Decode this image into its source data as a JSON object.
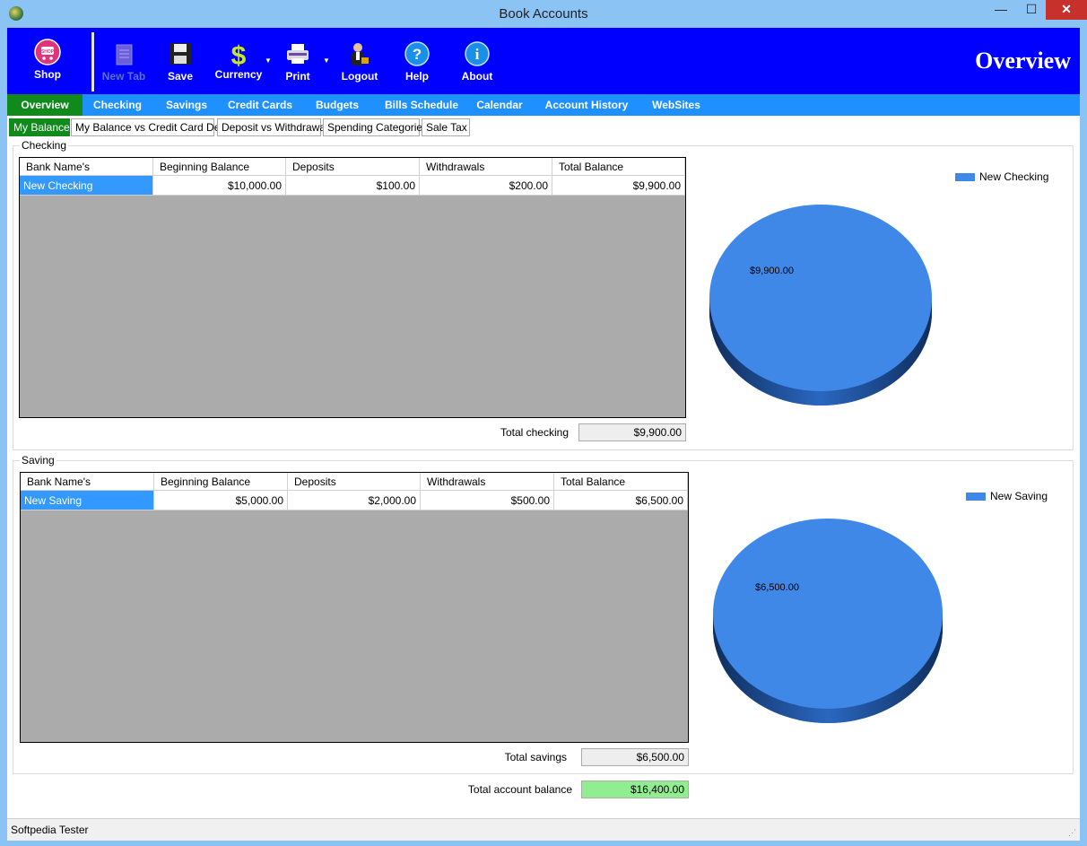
{
  "window": {
    "title": "Book Accounts",
    "min": "—",
    "max": "☐",
    "close": "✕"
  },
  "toolbar": {
    "shop": "Shop",
    "new_tab": "New Tab",
    "save": "Save",
    "currency": "Currency",
    "print": "Print",
    "logout": "Logout",
    "help": "Help",
    "about": "About",
    "section_title": "Overview"
  },
  "nav": {
    "items": [
      "Overview",
      "Checking",
      "Savings",
      "Credit Cards",
      "Budgets",
      "Bills Schedule",
      "Calendar",
      "Account History",
      "WebSites"
    ]
  },
  "subtabs": [
    "My Balance",
    "My Balance vs Credit Card Debt",
    "Deposit vs Withdrawal",
    "Spending Categories",
    "Sale Tax"
  ],
  "checking": {
    "group_label": "Checking",
    "columns": [
      "Bank Name's",
      "Beginning Balance",
      "Deposits",
      "Withdrawals",
      "Total Balance"
    ],
    "row": [
      "New Checking",
      "$10,000.00",
      "$100.00",
      "$200.00",
      "$9,900.00"
    ],
    "total_label": "Total checking",
    "total_value": "$9,900.00",
    "legend": "New Checking",
    "pie_label": "$9,900.00"
  },
  "saving": {
    "group_label": "Saving",
    "columns": [
      "Bank Name's",
      "Beginning Balance",
      "Deposits",
      "Withdrawals",
      "Total Balance"
    ],
    "row": [
      "New Saving",
      "$5,000.00",
      "$2,000.00",
      "$500.00",
      "$6,500.00"
    ],
    "total_label": "Total savings",
    "total_value": "$6,500.00",
    "legend": "New Saving",
    "pie_label": "$6,500.00"
  },
  "account_total": {
    "label": "Total account balance",
    "value": "$16,400.00"
  },
  "status": {
    "user": "Softpedia Tester"
  },
  "colors": {
    "toolbar": "#0000ff",
    "nav": "#1e90ff",
    "active_tab": "#118a1c",
    "pie": "#3f88e8",
    "total_highlight": "#90ee90"
  }
}
